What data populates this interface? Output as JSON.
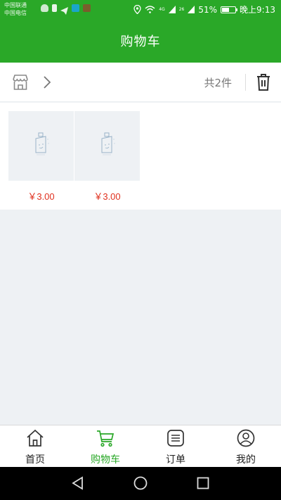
{
  "status_bar": {
    "carrier1": "中国联通",
    "carrier2": "中国电信",
    "network": "4G",
    "speed": "26",
    "battery_percent": "51%",
    "time": "晚上9:13",
    "battery_level": 0.51
  },
  "header": {
    "title": "购物车"
  },
  "shop_row": {
    "store_icon": "store-icon",
    "chevron_icon": "chevron-right-icon",
    "count": "共2件",
    "trash_icon": "trash-icon"
  },
  "products": [
    {
      "price": "￥3.00",
      "image": "placeholder-image-icon"
    },
    {
      "price": "￥3.00",
      "image": "placeholder-image-icon"
    }
  ],
  "bottom_nav": {
    "items": [
      {
        "label": "首页",
        "icon": "home-icon"
      },
      {
        "label": "购物车",
        "icon": "cart-icon",
        "active": true
      },
      {
        "label": "订单",
        "icon": "orders-icon"
      },
      {
        "label": "我的",
        "icon": "profile-icon"
      }
    ]
  },
  "colors": {
    "brand": "#2aa828",
    "price": "#e0301e",
    "background": "#eef1f4"
  }
}
